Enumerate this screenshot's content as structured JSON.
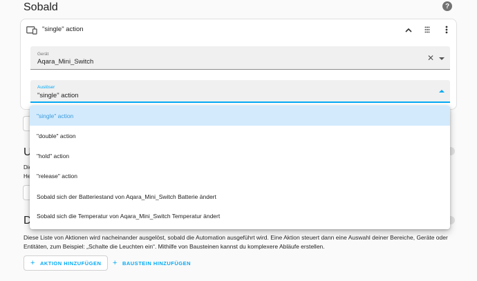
{
  "section": {
    "title": "Sobald",
    "help_icon": "help-icon"
  },
  "trigger_card": {
    "title": "\"single\" action",
    "icon": "device-icon",
    "collapse_icon": "chevron-up-icon",
    "drag_icon": "drag-handle-icon",
    "menu_icon": "more-vert-icon",
    "device_field": {
      "label": "Gerät",
      "value": "Aqara_Mini_Switch"
    },
    "trigger_field": {
      "label": "Auslöser",
      "value": "\"single\" action"
    }
  },
  "dropdown": {
    "options": [
      {
        "label": "\"single\" action",
        "selected": true
      },
      {
        "label": "\"double\" action",
        "selected": false
      },
      {
        "label": "\"hold\" action",
        "selected": false
      },
      {
        "label": "\"release\" action",
        "selected": false
      },
      {
        "label": "Sobald sich der Batteriestand von Aqara_Mini_Switch Batterie ändert",
        "selected": false
      },
      {
        "label": "Sobald sich die Temperatur von Aqara_Mini_Switch Temperatur ändert",
        "selected": false
      }
    ]
  },
  "background": {
    "conditions_title_fragment": "Un",
    "conditions_line1_fragment": "Die",
    "conditions_line2_fragment": "He",
    "actions_title_fragment": "Da",
    "actions_description": "Diese Liste von Aktionen wird nacheinander ausgelöst, sobald die Automation ausgeführt wird. Eine Aktion steuert dann eine Auswahl deiner Bereiche, Geräte oder Entitäten, zum Beispiel: „Schalte die Leuchten ein“. Mithilfe von Bausteinen kannst du komplexere Abläufe erstellen.",
    "add_action_label": "AKTION HINZUFÜGEN",
    "add_block_label": "BAUSTEIN HINZUFÜGEN"
  },
  "colors": {
    "accent": "#03a9f4",
    "selected_bg": "#d3eafd",
    "background": "#fafafa"
  }
}
